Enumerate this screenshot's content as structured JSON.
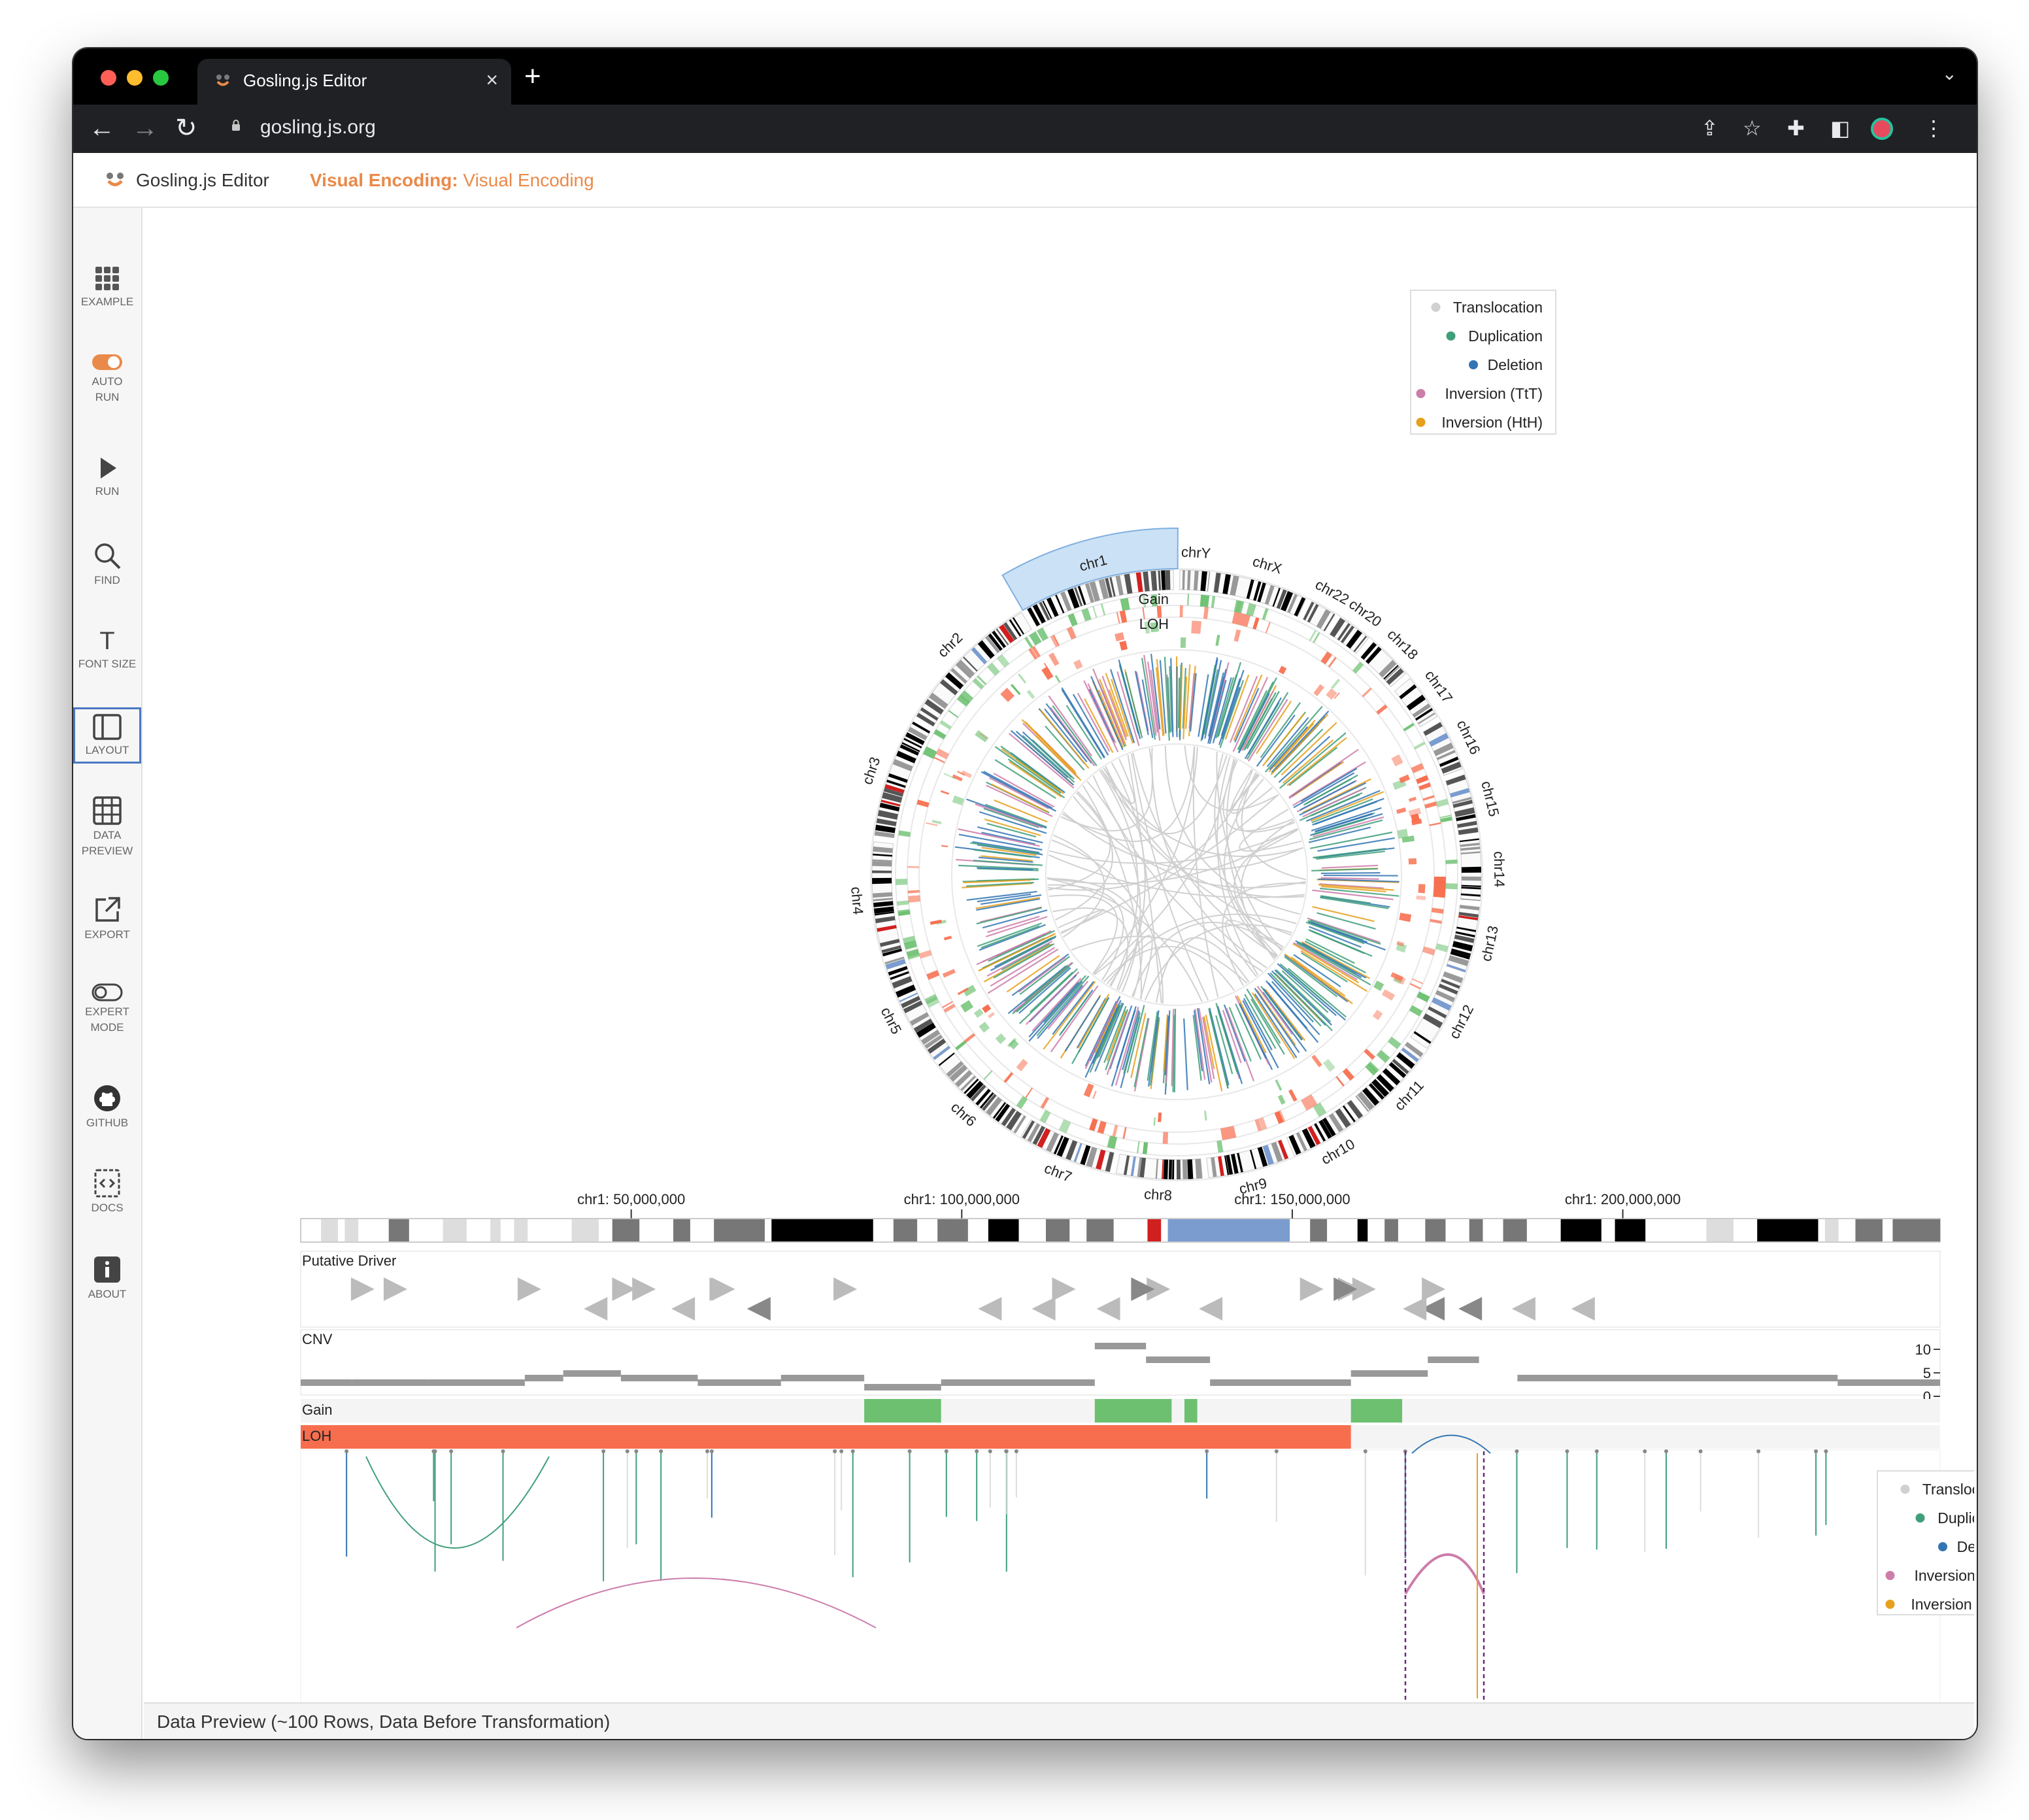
{
  "browser": {
    "tab_title": "Gosling.js Editor",
    "tab_close": "×",
    "new_tab": "+",
    "url": "gosling.js.org"
  },
  "app": {
    "title": "Gosling.js Editor",
    "subtitle_label": "Visual Encoding:",
    "subtitle_value": "Visual Encoding"
  },
  "sidebar": {
    "items": [
      {
        "label": "EXAMPLE",
        "icon": "grid-icon"
      },
      {
        "label": "AUTO RUN",
        "icon": "toggle-icon"
      },
      {
        "label": "RUN",
        "icon": "play-icon"
      },
      {
        "label": "FIND",
        "icon": "search-icon"
      },
      {
        "label": "FONT SIZE",
        "icon": "text-size-icon"
      },
      {
        "label": "LAYOUT",
        "icon": "layout-icon"
      },
      {
        "label": "DATA PREVIEW",
        "icon": "table-icon"
      },
      {
        "label": "EXPORT",
        "icon": "export-icon"
      },
      {
        "label": "EXPERT MODE",
        "icon": "toggle-off-icon"
      },
      {
        "label": "GITHUB",
        "icon": "github-icon"
      },
      {
        "label": "DOCS",
        "icon": "docs-icon"
      },
      {
        "label": "ABOUT",
        "icon": "info-icon"
      }
    ]
  },
  "circos": {
    "chromosomes": [
      "chr1",
      "chr2",
      "chr3",
      "chr4",
      "chr5",
      "chr6",
      "chr7",
      "chr8",
      "chr9",
      "chr10",
      "chr11",
      "chr12",
      "chr13",
      "chr14",
      "chr15",
      "chr16",
      "chr17",
      "chr18",
      "chr20",
      "chr22",
      "chrX",
      "chrY"
    ],
    "track_labels": {
      "gain": "Gain",
      "loh": "LOH"
    },
    "legend": [
      {
        "label": "Translocation",
        "color": "#d0d0d0"
      },
      {
        "label": "Duplication",
        "color": "#409f7a"
      },
      {
        "label": "Deletion",
        "color": "#3275b4"
      },
      {
        "label": "Inversion (TtT)",
        "color": "#cc7daa"
      },
      {
        "label": "Inversion (HtH)",
        "color": "#e6a01b"
      }
    ]
  },
  "linear": {
    "axis_labels": [
      "chr1: 50,000,000",
      "chr1: 100,000,000",
      "chr1: 150,000,000",
      "chr1: 200,000,000"
    ],
    "tracks": {
      "driver": "Putative Driver",
      "cnv": "CNV",
      "gain": "Gain",
      "loh": "LOH"
    },
    "cnv_ticks": [
      "10",
      "5",
      "0"
    ]
  },
  "data_preview": {
    "label": "Data Preview (~100 Rows, Data Before Transformation)"
  },
  "colors": {
    "accent": "#e98a4a",
    "gain": "#6cc070",
    "loh": "#f76e4e",
    "selection": "#a9cdee"
  }
}
